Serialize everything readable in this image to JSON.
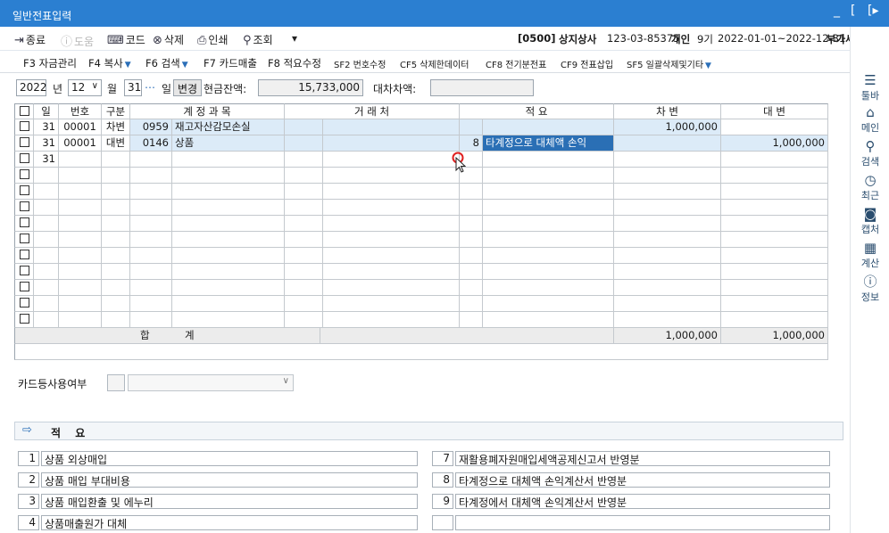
{
  "window": {
    "title": "일반전표입력",
    "controls": {
      "minimize": "_",
      "maximize": "[",
      "exit": "[▸"
    }
  },
  "toolbar": {
    "close": "종료",
    "help": "도움",
    "code": "코드",
    "delete": "삭제",
    "print": "인쇄",
    "search": "조회",
    "more": "▾"
  },
  "company": {
    "code": "[0500]",
    "name": "상지상사",
    "reg_no": "123-03-85375",
    "type": "개인",
    "period_no": "9기",
    "period": "2022-01-01~2022-12-31",
    "tax_label": "부가세",
    "year": "2022"
  },
  "fkeys": {
    "f3": "F3 자금관리",
    "f4": "F4 복사",
    "f6": "F6 검색",
    "f7": "F7 카드매출",
    "f8": "F8 적요수정",
    "sf2": "SF2 번호수정",
    "cf5": "CF5 삭제한데이터",
    "cf8": "CF8 전기분전표",
    "cf9": "CF9 전표삽입",
    "sf5": "SF5 일괄삭제및기타"
  },
  "side": {
    "toolbar": "툴바",
    "main": "메인",
    "search": "검색",
    "recent": "최근",
    "capture": "캡처",
    "calc": "계산",
    "info": "정보"
  },
  "filter": {
    "year": "2022",
    "year_unit": "년",
    "month": "12",
    "month_unit": "월",
    "day": "31",
    "day_unit": "일",
    "change": "변경",
    "cash_label": "현금잔액:",
    "cash_value": "15,733,000",
    "diff_label": "대차차액:",
    "diff_value": ""
  },
  "grid": {
    "headers": {
      "day": "일",
      "no": "번호",
      "type": "구분",
      "account": "계 정 과 목",
      "partner": "거 래 처",
      "memo": "적 요",
      "debit": "차 변",
      "credit": "대 변"
    },
    "rows": [
      {
        "day": "31",
        "no": "00001",
        "type": "차변",
        "code": "0959",
        "account": "재고자산감모손실",
        "memo_no": "",
        "memo": "",
        "debit": "1,000,000",
        "credit": ""
      },
      {
        "day": "31",
        "no": "00001",
        "type": "대변",
        "code": "0146",
        "account": "상품",
        "memo_no": "8",
        "memo": "타계정으로 대체액 손익",
        "debit": "",
        "credit": "1,000,000"
      },
      {
        "day": "31",
        "no": "",
        "type": "",
        "code": "",
        "account": "",
        "memo_no": "",
        "memo": "",
        "debit": "",
        "credit": ""
      }
    ],
    "total": {
      "label_a": "합",
      "label_b": "계",
      "debit": "1,000,000",
      "credit": "1,000,000"
    }
  },
  "card": {
    "label": "카드등사용여부"
  },
  "memo_panel": {
    "title": "적 요",
    "left": [
      {
        "num": "1",
        "text": "상품 외상매입"
      },
      {
        "num": "2",
        "text": "상품 매입 부대비용"
      },
      {
        "num": "3",
        "text": "상품 매입환출 및 에누리"
      },
      {
        "num": "4",
        "text": "상품매출원가 대체"
      }
    ],
    "right": [
      {
        "num": "7",
        "text": "재활용폐자원매입세액공제신고서 반영분"
      },
      {
        "num": "8",
        "text": "타계정으로 대체액 손익계산서 반영분"
      },
      {
        "num": "9",
        "text": "타계정에서 대체액 손익계산서 반영분"
      },
      {
        "num": "",
        "text": ""
      }
    ]
  },
  "colors": {
    "title_bar": "#2b7fd1",
    "selection": "#2a6fb5",
    "row_highlight": "#dcebf8"
  },
  "icons": [
    "exit-icon",
    "help-icon",
    "code-icon",
    "delete-icon",
    "print-icon",
    "search-icon",
    "hamburger-icon",
    "home-icon",
    "magnifier-icon",
    "clock-icon",
    "camera-icon",
    "calculator-icon",
    "info-icon",
    "arrow-right-icon",
    "dropdown-icon"
  ]
}
